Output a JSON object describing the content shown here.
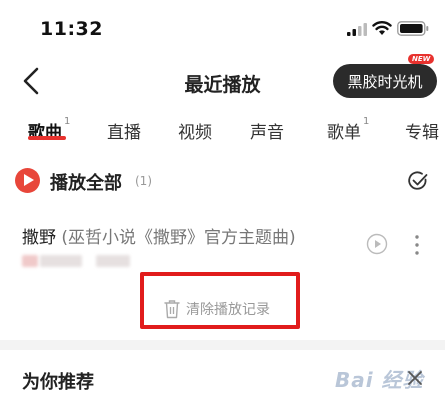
{
  "status_bar": {
    "time": "11:32"
  },
  "header": {
    "title": "最近播放",
    "vinyl_button": "黑胶时光机",
    "vinyl_badge": "NEW"
  },
  "tabs": [
    {
      "label": "歌曲",
      "count": "1",
      "active": true
    },
    {
      "label": "直播",
      "count": ""
    },
    {
      "label": "视频",
      "count": ""
    },
    {
      "label": "声音",
      "count": ""
    },
    {
      "label": "歌单",
      "count": "1"
    },
    {
      "label": "专辑",
      "count": ""
    }
  ],
  "play_all": {
    "label": "播放全部",
    "count": "(1)"
  },
  "song": {
    "title": "撒野",
    "subtitle": "(巫哲小说《撒野》官方主题曲)"
  },
  "clear_history": {
    "label": "清除播放记录"
  },
  "recommend": {
    "title": "为你推荐"
  },
  "watermark": {
    "text": "Bai 经验"
  },
  "colors": {
    "accent": "#e8322e",
    "highlight_box": "#e11c1c",
    "vinyl_bg": "#2b2b2b"
  },
  "icons": [
    "back-icon",
    "play-icon",
    "multi-select-check-icon",
    "mv-play-icon",
    "more-vertical-icon",
    "trash-icon",
    "close-icon"
  ]
}
